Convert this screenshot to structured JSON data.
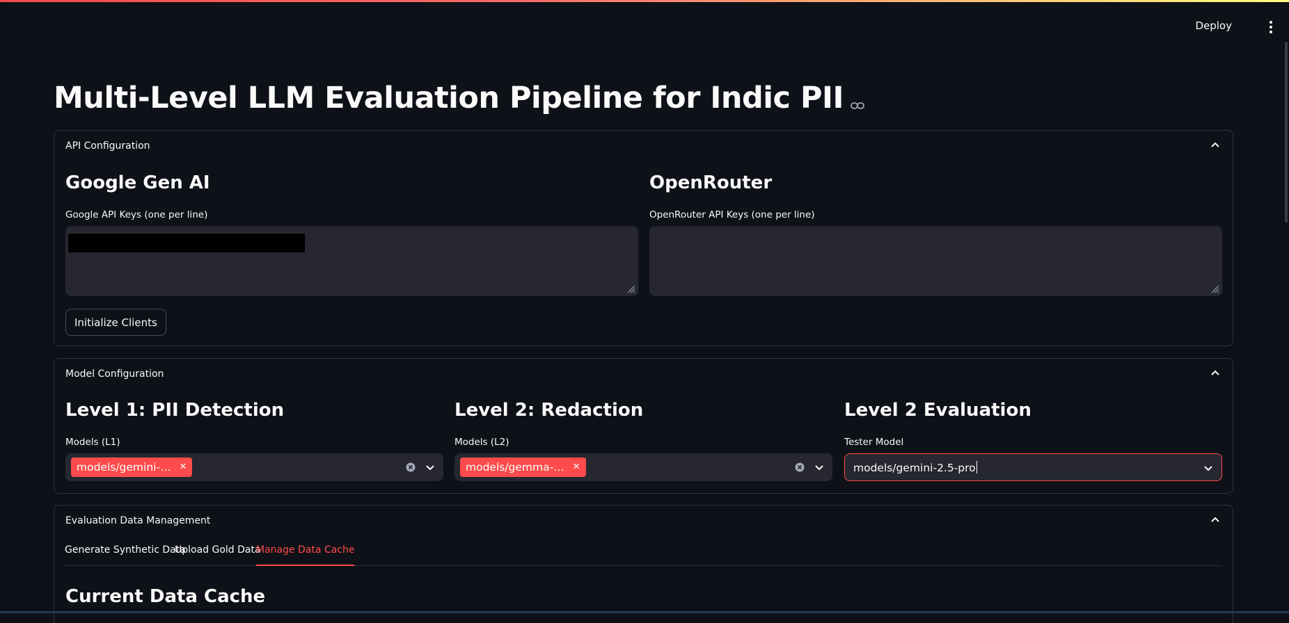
{
  "header": {
    "deploy_label": "Deploy",
    "menu_icon": "vertical-dots-icon"
  },
  "page": {
    "title": "Multi-Level LLM Evaluation Pipeline for Indic PII",
    "title_icon": "link-icon"
  },
  "api_config": {
    "header": "API Configuration",
    "google": {
      "heading": "Google Gen AI",
      "label": "Google API Keys (one per line)",
      "value": ""
    },
    "openrouter": {
      "heading": "OpenRouter",
      "label": "OpenRouter API Keys (one per line)",
      "value": ""
    },
    "init_button": "Initialize Clients"
  },
  "model_config": {
    "header": "Model Configuration",
    "level1": {
      "heading": "Level 1: PII Detection",
      "label": "Models (L1)",
      "selected": [
        "models/gemini-…"
      ]
    },
    "level2": {
      "heading": "Level 2: Redaction",
      "label": "Models (L2)",
      "selected": [
        "models/gemma-…"
      ]
    },
    "eval": {
      "heading": "Level 2 Evaluation",
      "label": "Tester Model",
      "value": "models/gemini-2.5-pro"
    }
  },
  "data_mgmt": {
    "header": "Evaluation Data Management",
    "tabs": [
      "Generate Synthetic Data",
      "Upload Gold Data",
      "Manage Data Cache"
    ],
    "active_tab": "Manage Data Cache",
    "section_heading": "Current Data Cache"
  },
  "colors": {
    "accent": "#ff4b4b",
    "background": "#0e1117",
    "input_bg": "#262730",
    "border": "#31333f"
  }
}
